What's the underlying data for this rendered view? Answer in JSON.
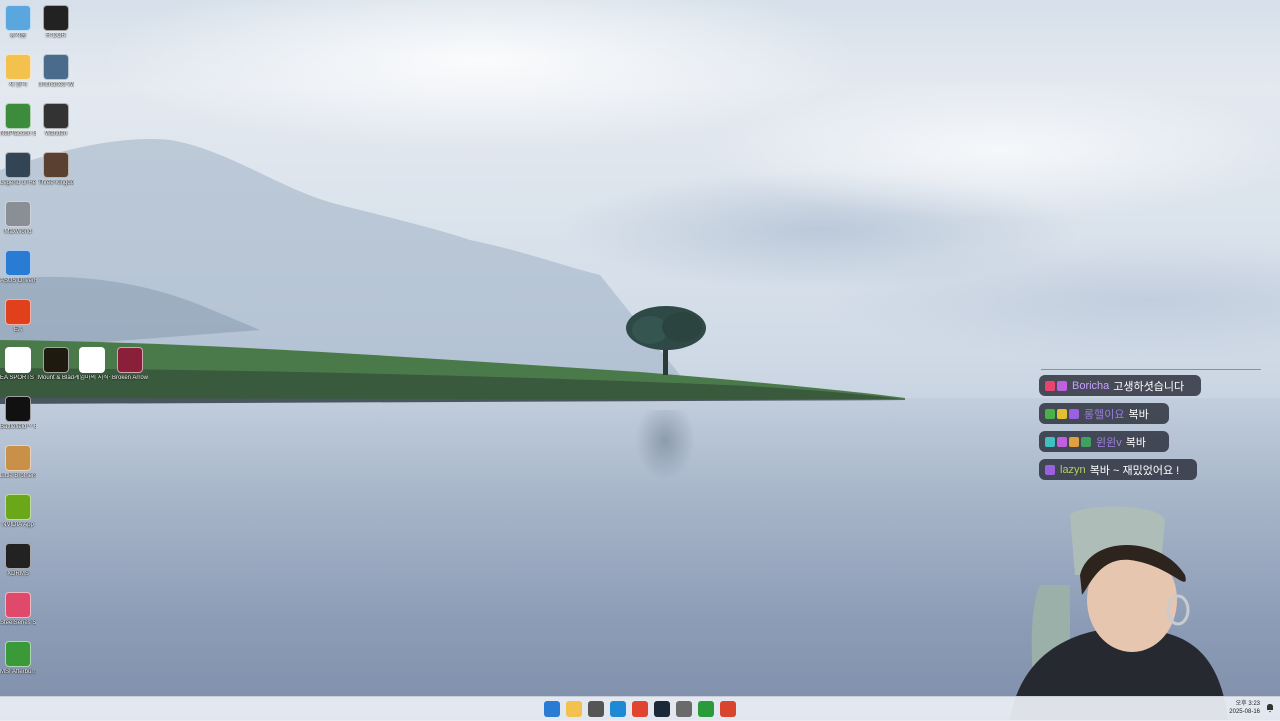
{
  "desktop": {
    "icons": [
      {
        "label": "휴지통",
        "icon": "recycle-bin-icon",
        "color": "#5aa7e0"
      },
      {
        "label": "R-DOR",
        "icon": "r-dor-icon",
        "color": "#222222"
      },
      {
        "label": "새 폴더",
        "icon": "folder-icon",
        "color": "#f2c14e"
      },
      {
        "label": "Uncharted Waters ...",
        "icon": "uncharted-waters-icon",
        "color": "#4a6b8c"
      },
      {
        "label": "NetPlaceon GPU Z",
        "icon": "gpu-icon",
        "color": "#3c8c3c"
      },
      {
        "label": "Wanden",
        "icon": "wanden-icon",
        "color": "#333333"
      },
      {
        "label": "Legend of Heroes ...",
        "icon": "legend-of-heroes-icon",
        "color": "#334455"
      },
      {
        "label": "Three Kingdoms ...",
        "icon": "three-kingdoms-icon",
        "color": "#5a4030"
      },
      {
        "label": "MaxWorld",
        "icon": "maxworld-icon",
        "color": "#8a8f96"
      },
      {
        "label": "ASUS DriverHub",
        "icon": "asus-gear-icon",
        "color": "#2a7bd4"
      },
      {
        "label": "EA",
        "icon": "ea-icon",
        "color": "#e0401c"
      },
      {
        "label": "EA SPORTS FC ONLINE",
        "icon": "chrome-icon",
        "color": "#ffffff"
      },
      {
        "label": "Mount & Blade II ...",
        "icon": "mount-blade-icon",
        "color": "#1f1a10"
      },
      {
        "label": "게임마의 지식직 ...",
        "icon": "chrome-icon",
        "color": "#ffffff"
      },
      {
        "label": "Broken Arrow",
        "icon": "broken-arrow-icon",
        "color": "#8a1f3a"
      },
      {
        "label": "Battlefield™ 6 Open Beta",
        "icon": "battlefield-icon",
        "color": "#111111"
      },
      {
        "label": "Little Brothers",
        "icon": "little-brothers-icon",
        "color": "#c89048"
      },
      {
        "label": "NVIDIA App",
        "icon": "nvidia-icon",
        "color": "#6aa81a"
      },
      {
        "label": "XDRMS",
        "icon": "xdrms-icon",
        "color": "#222222"
      },
      {
        "label": "SteelSeries Sonar",
        "icon": "steelseries-icon",
        "color": "#e04a6a"
      },
      {
        "label": "MSI Afterburner",
        "icon": "msi-afterburner-icon",
        "color": "#3a9a3a"
      }
    ]
  },
  "chat": {
    "messages": [
      {
        "user": "Boricha",
        "user_color": "#c8a0ff",
        "text": "고생하셧습니다",
        "badges": [
          "#e8446e",
          "#c060e0"
        ]
      },
      {
        "user": "롱헬이요",
        "user_color": "#9a7ae0",
        "text": "복바",
        "badges": [
          "#4ab04a",
          "#e0c030",
          "#9a60e0"
        ]
      },
      {
        "user": "윈윈v",
        "user_color": "#a080e0",
        "text": "복바",
        "badges": [
          "#40c0c0",
          "#c060e0",
          "#e0a040",
          "#40a060"
        ]
      },
      {
        "user": "lazyn",
        "user_color": "#b0d060",
        "text": "복바 ~ 재밌었어요 !",
        "badges": [
          "#9a60e0"
        ]
      }
    ]
  },
  "taskbar": {
    "apps": [
      {
        "name": "start-icon",
        "color": "#2a7bd4"
      },
      {
        "name": "file-explorer-icon",
        "color": "#f2c14e"
      },
      {
        "name": "app-icon",
        "color": "#555555"
      },
      {
        "name": "edge-icon",
        "color": "#1e8ad6"
      },
      {
        "name": "chrome-icon",
        "color": "#e0442e"
      },
      {
        "name": "steam-icon",
        "color": "#1b2838"
      },
      {
        "name": "settings-icon",
        "color": "#6a6a6a"
      },
      {
        "name": "xbox-icon",
        "color": "#2a9a3a"
      },
      {
        "name": "app-red-icon",
        "color": "#d8442e"
      }
    ],
    "clock_time": "오후 3:23",
    "clock_date": "2025-08-16"
  }
}
